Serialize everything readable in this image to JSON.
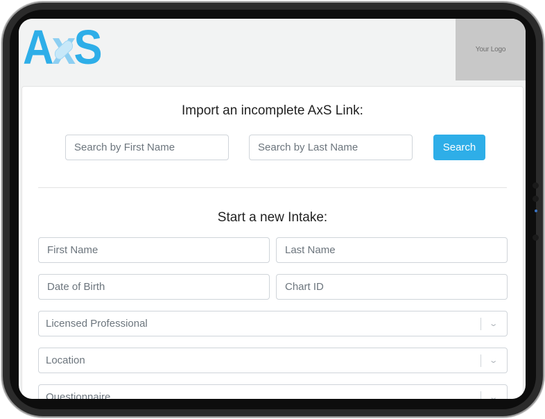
{
  "brand": {
    "name": "AxS",
    "logo_placeholder": "Your Logo"
  },
  "import_section": {
    "title": "Import an incomplete AxS Link:",
    "first_name_placeholder": "Search by First Name",
    "last_name_placeholder": "Search by Last Name",
    "search_label": "Search"
  },
  "intake_section": {
    "title": "Start a new Intake:",
    "first_name_placeholder": "First Name",
    "last_name_placeholder": "Last Name",
    "dob_placeholder": "Date of Birth",
    "chart_id_placeholder": "Chart ID",
    "selects": [
      {
        "label": "Licensed Professional"
      },
      {
        "label": "Location"
      },
      {
        "label": "Questionnaire"
      }
    ]
  },
  "colors": {
    "accent": "#2eaee8",
    "logo_bg": "#c8c8c8",
    "header_bg": "#f2f3f3"
  },
  "icons": {
    "select_chevron": "chevron-down-icon"
  }
}
